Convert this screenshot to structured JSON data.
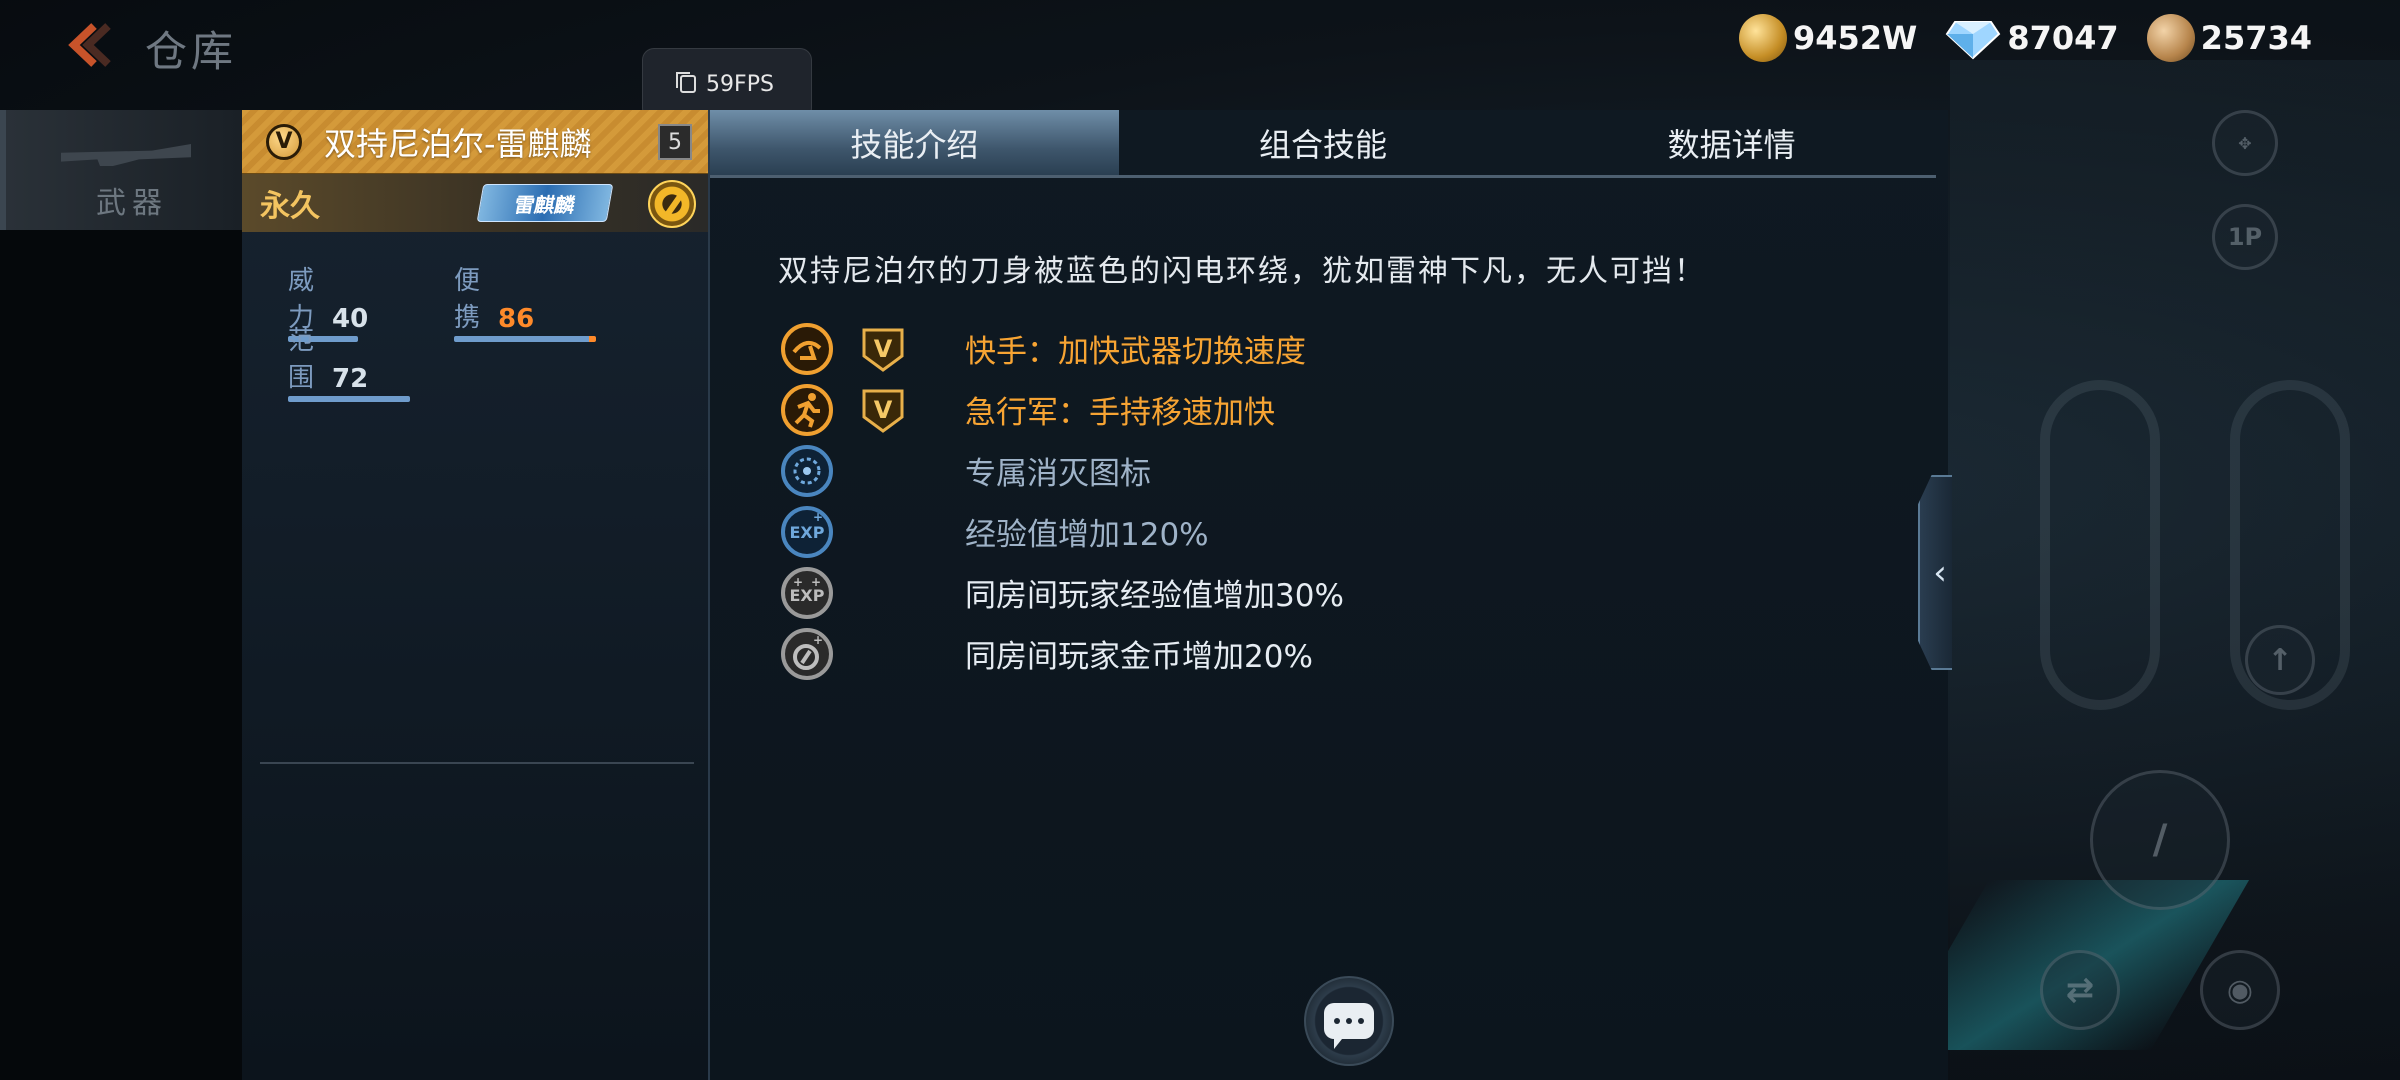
{
  "header": {
    "title": "仓库",
    "fps_label": "59FPS"
  },
  "currencies": [
    {
      "icon": "gold-coin-icon",
      "value": "9452W"
    },
    {
      "icon": "diamond-icon",
      "value": "87047"
    },
    {
      "icon": "honor-coin-icon",
      "value": "25734"
    }
  ],
  "sidebar": {
    "active_tab": "武器"
  },
  "weapon": {
    "name": "双持尼泊尔-雷麒麟",
    "badge": "V",
    "level": "5",
    "duration": "永久",
    "tag": "雷麒麟",
    "stats": [
      {
        "label": "威力",
        "value": "40"
      },
      {
        "label": "便携",
        "value": "86"
      },
      {
        "label": "范围",
        "value": "72"
      }
    ]
  },
  "tabs": [
    {
      "label": "技能介绍",
      "active": true
    },
    {
      "label": "组合技能",
      "active": false
    },
    {
      "label": "数据详情",
      "active": false
    }
  ],
  "description": "双持尼泊尔的刀身被蓝色的闪电环绕，犹如雷神下凡，无人可挡！",
  "skills": [
    {
      "icon": "quick-hand-icon",
      "vip": true,
      "text": "快手：加快武器切换速度",
      "color": "orange"
    },
    {
      "icon": "running-man-icon",
      "vip": true,
      "text": "急行军：手持移速加快",
      "color": "orange"
    },
    {
      "icon": "kill-icon-badge",
      "vip": false,
      "text": "专属消灭图标",
      "color": "blue"
    },
    {
      "icon": "exp-icon",
      "vip": false,
      "text": "经验值增加120%",
      "color": "blue"
    },
    {
      "icon": "room-exp-icon",
      "vip": false,
      "text": "同房间玩家经验值增加30%",
      "color": "white"
    },
    {
      "icon": "room-coin-icon",
      "vip": false,
      "text": "同房间玩家金币增加20%",
      "color": "white"
    }
  ],
  "colors": {
    "accent_gold": "#d49a3a",
    "skill_orange": "#f7a433",
    "skill_blue": "#9fb3c8",
    "stat_highlight": "#ff8a2a"
  }
}
